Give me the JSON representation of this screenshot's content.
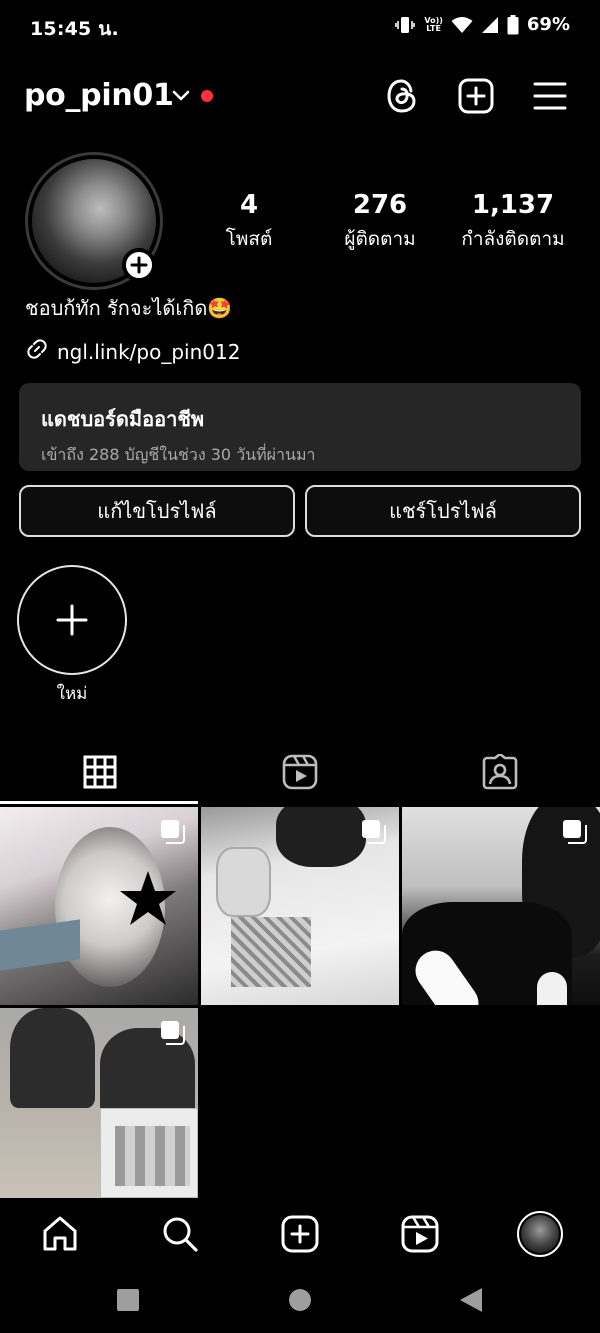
{
  "status": {
    "time": "15:45 น.",
    "volte_top": "Vo))",
    "volte_bottom": "LTE",
    "battery": "69%"
  },
  "header": {
    "username": "po_pin01"
  },
  "stats": [
    {
      "num": "4",
      "label": "โพสต์"
    },
    {
      "num": "276",
      "label": "ผู้ติดตาม"
    },
    {
      "num": "1,137",
      "label": "กำลังติดตาม"
    }
  ],
  "bio": "ชอบก้ทัก รักจะได้เกิด🤩",
  "link": "ngl.link/po_pin012",
  "dashboard": {
    "title": "แดชบอร์ดมืออาชีพ",
    "subtitle": "เข้าถึง 288 บัญชีในช่วง 30 วันที่ผ่านมา"
  },
  "buttons": {
    "edit": "แก้ไขโปรไฟล์",
    "share": "แชร์โปรไฟล์"
  },
  "highlight": {
    "new_label": "ใหม่"
  },
  "icons": {
    "threads": "threads-icon",
    "add": "add-post-icon",
    "menu": "menu-icon",
    "grid": "grid-icon",
    "reels": "reels-icon",
    "tagged": "tagged-icon",
    "home": "home-icon",
    "search": "search-icon",
    "create": "create-icon",
    "reels_nav": "reels-nav-icon"
  }
}
